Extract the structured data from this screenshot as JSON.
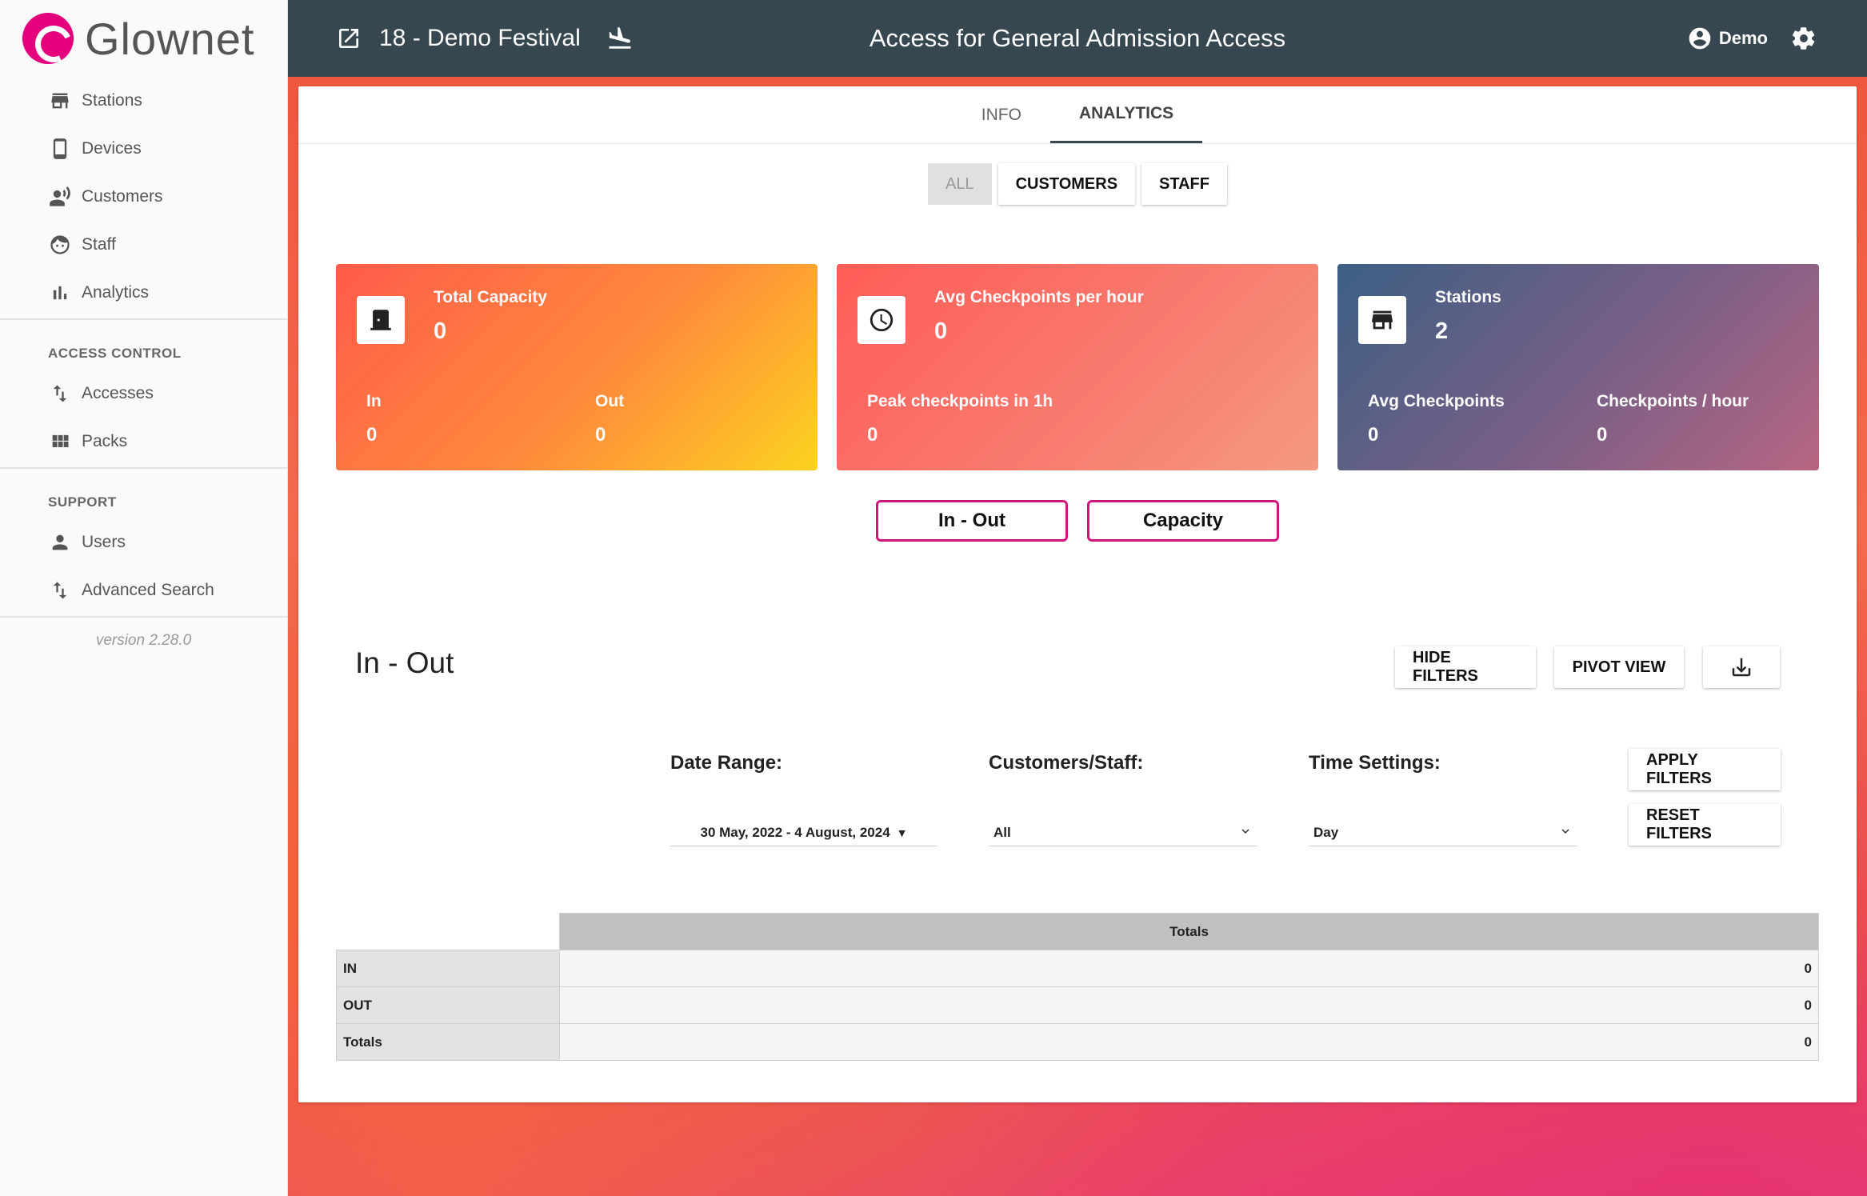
{
  "app": {
    "name": "Glownet",
    "version": "version 2.28.0"
  },
  "sidebar": {
    "items": [
      {
        "label": "Stations",
        "icon": "store-icon"
      },
      {
        "label": "Devices",
        "icon": "phone-icon"
      },
      {
        "label": "Customers",
        "icon": "customers-icon"
      },
      {
        "label": "Staff",
        "icon": "face-icon"
      },
      {
        "label": "Analytics",
        "icon": "bar-chart-icon"
      }
    ],
    "access_control": {
      "heading": "ACCESS CONTROL",
      "items": [
        {
          "label": "Accesses",
          "icon": "swap-vert-icon"
        },
        {
          "label": "Packs",
          "icon": "grid-icon"
        }
      ]
    },
    "support": {
      "heading": "SUPPORT",
      "items": [
        {
          "label": "Users",
          "icon": "person-icon"
        },
        {
          "label": "Advanced Search",
          "icon": "swap-vert-icon"
        }
      ]
    }
  },
  "topbar": {
    "event": "18 - Demo Festival",
    "title": "Access for General Admission Access",
    "user": "Demo"
  },
  "tabs": [
    "INFO",
    "ANALYTICS"
  ],
  "segments": [
    "ALL",
    "CUSTOMERS",
    "STAFF"
  ],
  "stats": {
    "capacity": {
      "label": "Total Capacity",
      "value": "0",
      "in_label": "In",
      "in_value": "0",
      "out_label": "Out",
      "out_value": "0"
    },
    "checkpoints": {
      "label": "Avg Checkpoints per hour",
      "value": "0",
      "peak_label": "Peak checkpoints in 1h",
      "peak_value": "0"
    },
    "stations": {
      "label": "Stations",
      "value": "2",
      "avg_label": "Avg Checkpoints",
      "avg_value": "0",
      "rate_label": "Checkpoints / hour",
      "rate_value": "0"
    }
  },
  "chart_toggles": [
    "In - Out",
    "Capacity"
  ],
  "section": {
    "title": "In - Out",
    "hide_filters": "HIDE FILTERS",
    "pivot_view": "PIVOT VIEW",
    "apply_filters": "APPLY FILTERS",
    "reset_filters": "RESET FILTERS"
  },
  "filters": {
    "date_label": "Date Range:",
    "date_value": "30 May, 2022 - 4 August, 2024",
    "customers_label": "Customers/Staff:",
    "customers_value": "All",
    "time_label": "Time Settings:",
    "time_value": "Day"
  },
  "table": {
    "header": "Totals",
    "rows": [
      {
        "label": "IN",
        "value": "0"
      },
      {
        "label": "OUT",
        "value": "0"
      },
      {
        "label": "Totals",
        "value": "0"
      }
    ]
  },
  "colors": {
    "topbar": "#37474f",
    "brand": "#e4007c",
    "toggle_border": "#d1147a"
  }
}
